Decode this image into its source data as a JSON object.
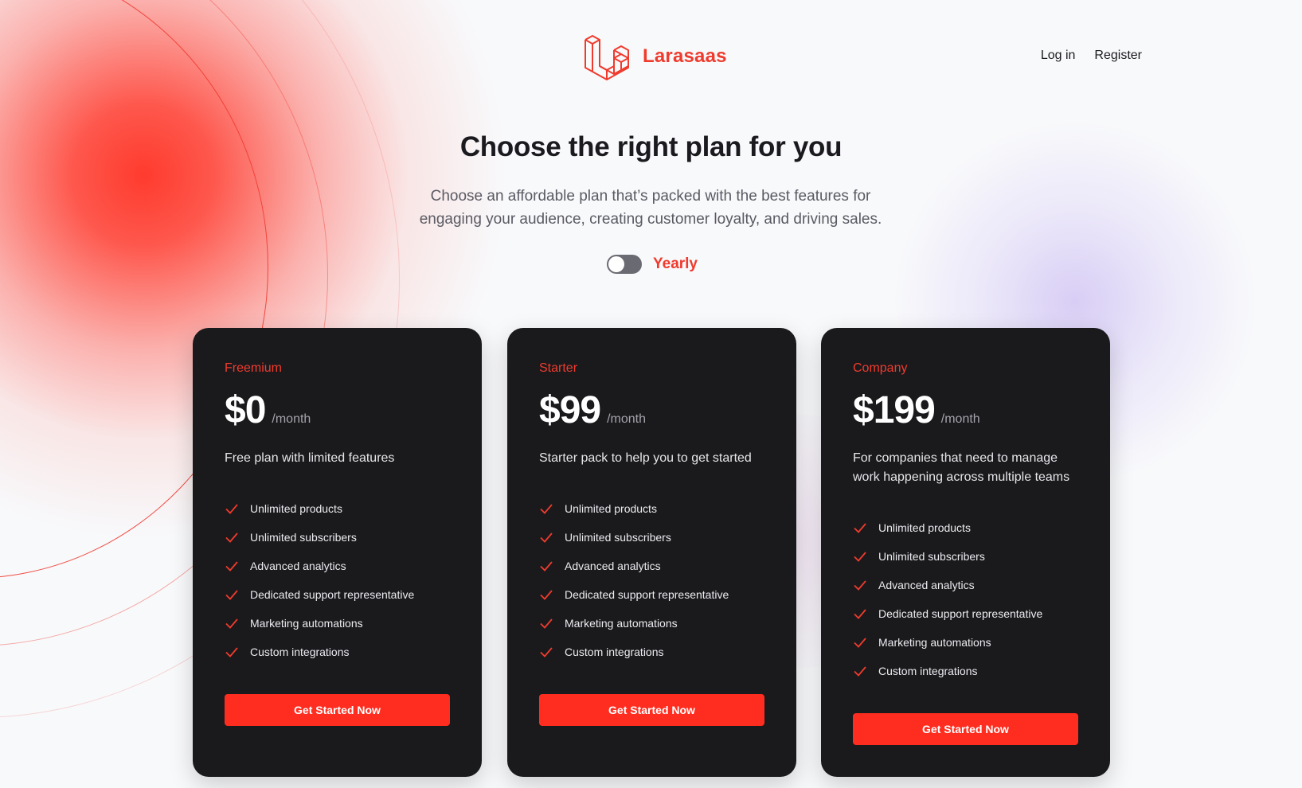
{
  "brand": {
    "name": "Larasaas",
    "logo_icon": "laravel-logo-icon",
    "color": "#ef3b2d"
  },
  "nav": {
    "login": "Log in",
    "register": "Register"
  },
  "hero": {
    "title": "Choose the right plan for you",
    "subtitle_line1": "Choose an affordable plan that’s packed with the best features for",
    "subtitle_line2": "engaging your audience, creating customer loyalty, and driving sales."
  },
  "billing_toggle": {
    "label": "Yearly",
    "enabled": false
  },
  "plans": [
    {
      "name": "Freemium",
      "price": "$0",
      "period": "/month",
      "description": "Free plan with limited features",
      "features": [
        "Unlimited products",
        "Unlimited subscribers",
        "Advanced analytics",
        "Dedicated support representative",
        "Marketing automations",
        "Custom integrations"
      ],
      "cta": "Get Started Now"
    },
    {
      "name": "Starter",
      "price": "$99",
      "period": "/month",
      "description": "Starter pack to help you to get started",
      "features": [
        "Unlimited products",
        "Unlimited subscribers",
        "Advanced analytics",
        "Dedicated support representative",
        "Marketing automations",
        "Custom integrations"
      ],
      "cta": "Get Started Now"
    },
    {
      "name": "Company",
      "price": "$199",
      "period": "/month",
      "description": "For companies that need to manage work happening across multiple teams",
      "features": [
        "Unlimited products",
        "Unlimited subscribers",
        "Advanced analytics",
        "Dedicated support representative",
        "Marketing automations",
        "Custom integrations"
      ],
      "cta": "Get Started Now"
    }
  ],
  "colors": {
    "accent": "#ff2d20",
    "card_bg": "#1a1a1d",
    "page_bg": "#f8f9fb"
  },
  "icons": {
    "feature": "check-icon",
    "toggle": "toggle-switch"
  }
}
